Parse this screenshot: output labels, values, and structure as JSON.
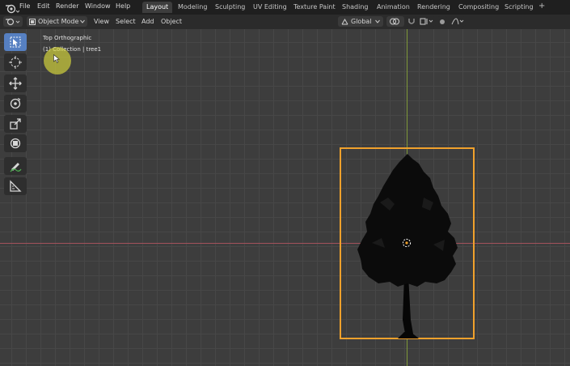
{
  "topbar": {
    "menus": [
      "File",
      "Edit",
      "Render",
      "Window",
      "Help"
    ],
    "workspaces": [
      "Layout",
      "Modeling",
      "Sculpting",
      "UV Editing",
      "Texture Paint",
      "Shading",
      "Animation",
      "Rendering",
      "Compositing",
      "Scripting"
    ],
    "active_workspace": "Layout",
    "add_label": "+"
  },
  "header": {
    "mode": "Object Mode",
    "menus": [
      "View",
      "Select",
      "Add",
      "Object"
    ],
    "orientation": "Global"
  },
  "viewport": {
    "view_name": "Top Orthographic",
    "collection_info": "(1) Collection | tree1"
  },
  "toolbar": {
    "tools": [
      "select-box-icon",
      "cursor-icon",
      "move-icon",
      "rotate-icon",
      "scale-icon",
      "transform-icon",
      "annotate-icon",
      "measure-icon"
    ],
    "active_tool": "select-box-icon"
  },
  "colors": {
    "accent": "#5680c2",
    "selection": "#f0a12c",
    "x_axis": "#a3525c",
    "y_axis": "#7f9a3a"
  }
}
